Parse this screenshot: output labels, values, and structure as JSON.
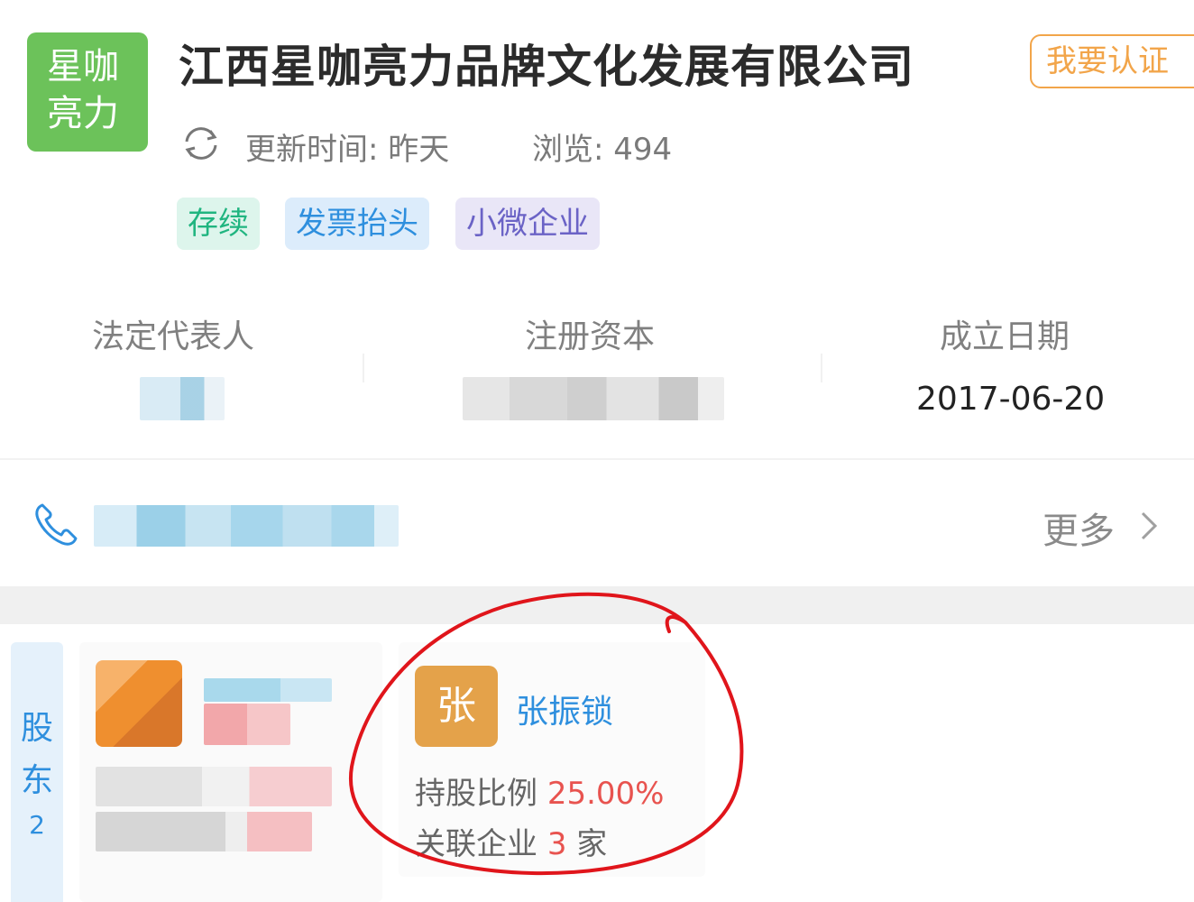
{
  "header": {
    "logo_line1": "星咖",
    "logo_line2": "亮力",
    "company_name": "江西星咖亮力品牌文化发展有限公司",
    "certify_button": "我要认证",
    "update_time": "更新时间: 昨天",
    "views": "浏览: 494"
  },
  "tags": [
    "存续",
    "发票抬头",
    "小微企业"
  ],
  "info": {
    "legal_rep_label": "法定代表人",
    "reg_capital_label": "注册资本",
    "founded_label": "成立日期",
    "founded_value": "2017-06-20"
  },
  "contact": {
    "more_label": "更多"
  },
  "shareholders": {
    "section_char1": "股",
    "section_char2": "东",
    "section_count": "2",
    "featured": {
      "avatar_char": "张",
      "name": "张振锁",
      "stake_label": "持股比例",
      "stake_value": "25.00%",
      "related_label": "关联企业",
      "related_count": "3",
      "related_unit": "家"
    }
  },
  "colors": {
    "logo_green": "#6cc25a",
    "certify_orange": "#f2a54a",
    "link_blue": "#2e8fde",
    "value_red": "#e8534f",
    "annotation_red": "#e0151b"
  },
  "icons": [
    "refresh-icon",
    "phone-icon",
    "chevron-right-icon"
  ]
}
